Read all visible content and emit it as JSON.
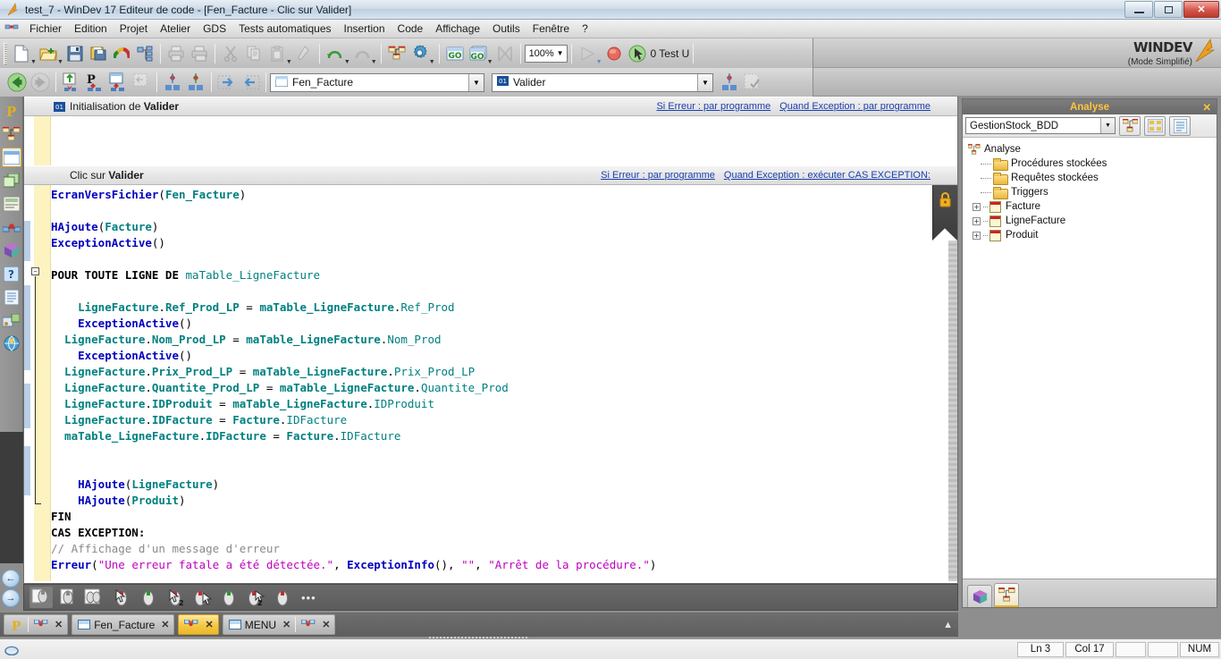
{
  "window": {
    "title": "test_7 - WinDev 17  Editeur de code - [Fen_Facture - Clic sur Valider]",
    "app_icon": "windev-flame-icon",
    "minimize": "–",
    "maximize": "❐",
    "close": "✕"
  },
  "menubar": {
    "logo_icon": "windev-small-icon",
    "items": [
      "Fichier",
      "Edition",
      "Projet",
      "Atelier",
      "GDS",
      "Tests automatiques",
      "Insertion",
      "Code",
      "Affichage",
      "Outils",
      "Fenêtre",
      "?"
    ]
  },
  "toolbar_main": {
    "zoom_value": "100%",
    "test_label": "0 Test U",
    "buttons": [
      {
        "name": "new-document-button",
        "icon": "page-icon",
        "dropdown": true
      },
      {
        "name": "open-project-button",
        "icon": "folder-open-icon",
        "dropdown": true
      },
      {
        "name": "save-button",
        "icon": "floppy-disk-icon",
        "dropdown": false
      },
      {
        "name": "save-all-button",
        "icon": "floppy-multi-icon",
        "dropdown": false
      },
      {
        "name": "dashboard-button",
        "icon": "gauge-icon",
        "dropdown": false
      },
      {
        "name": "project-structure-button",
        "icon": "tree-nodes-icon",
        "dropdown": false
      },
      {
        "name": "print-button",
        "icon": "printer-icon",
        "dropdown": false
      },
      {
        "name": "print-preview-button",
        "icon": "printer-preview-icon",
        "dropdown": false
      },
      {
        "name": "cut-button",
        "icon": "scissors-icon",
        "dropdown": false
      },
      {
        "name": "copy-button",
        "icon": "copy-icon",
        "dropdown": false
      },
      {
        "name": "paste-button",
        "icon": "clipboard-icon",
        "dropdown": true
      },
      {
        "name": "format-painter-button",
        "icon": "brush-icon",
        "dropdown": false
      },
      {
        "name": "undo-button",
        "icon": "undo-arrow-icon",
        "dropdown": true
      },
      {
        "name": "redo-button",
        "icon": "redo-arrow-icon",
        "dropdown": true
      },
      {
        "name": "analysis-button",
        "icon": "analysis-icon",
        "dropdown": false
      },
      {
        "name": "settings-button",
        "icon": "gear-icon",
        "dropdown": true
      },
      {
        "name": "go-button",
        "icon": "go-icon",
        "dropdown": false
      },
      {
        "name": "go-project-button",
        "icon": "go-project-icon",
        "dropdown": true
      },
      {
        "name": "stop-button",
        "icon": "hourglass-x-icon",
        "dropdown": false
      }
    ],
    "run_button_icon": "play-triangle-icon",
    "record_button_icon": "record-circle-icon",
    "testu_icon": "cursor-green-icon"
  },
  "toolbar_code": {
    "back_icon": "back-arrow-icon",
    "forward_icon": "forward-arrow-icon",
    "element_combo": {
      "icon": "window-icon",
      "value": "Fen_Facture"
    },
    "event_combo": {
      "icon": "code-event-icon",
      "value": "Valider"
    },
    "buttons": [
      {
        "name": "code-up-button",
        "icon": "code-up-icon"
      },
      {
        "name": "code-process-button",
        "icon": "code-process-icon"
      },
      {
        "name": "code-window-button",
        "icon": "code-window-icon"
      },
      {
        "name": "code-indent-button",
        "icon": "code-indent-icon"
      },
      {
        "name": "code-prev-button",
        "icon": "code-prev-icon"
      },
      {
        "name": "code-next-button",
        "icon": "code-next-icon"
      },
      {
        "name": "code-expand-button",
        "icon": "expand-right-icon"
      },
      {
        "name": "code-collapse-button",
        "icon": "collapse-left-icon"
      }
    ],
    "right_buttons": [
      {
        "name": "code-goto-button",
        "icon": "code-goto-icon"
      },
      {
        "name": "code-check-button",
        "icon": "code-check-icon"
      }
    ]
  },
  "brand": {
    "name": "WINDEV",
    "mode": "(Mode Simplifié)",
    "logo_icon": "windev-flame-icon",
    "colors_icon": "color-wheel-icon"
  },
  "leftbar": {
    "items": [
      {
        "name": "sidebar-item-project",
        "icon": "project-p-icon",
        "selected": false
      },
      {
        "name": "sidebar-item-analysis",
        "icon": "analysis-icon",
        "selected": false
      },
      {
        "name": "sidebar-item-window",
        "icon": "window-blue-icon",
        "selected": true
      },
      {
        "name": "sidebar-item-pages",
        "icon": "pages-green-icon",
        "selected": false
      },
      {
        "name": "sidebar-item-report",
        "icon": "report-icon",
        "selected": false
      },
      {
        "name": "sidebar-item-procedures",
        "icon": "procedures-icon",
        "selected": false
      },
      {
        "name": "sidebar-item-classes",
        "icon": "class-cube-icon",
        "selected": false
      },
      {
        "name": "sidebar-item-help",
        "icon": "question-help-icon",
        "selected": false
      },
      {
        "name": "sidebar-item-documents",
        "icon": "document-list-icon",
        "selected": false
      },
      {
        "name": "sidebar-item-components",
        "icon": "component-icon",
        "selected": false
      },
      {
        "name": "sidebar-item-web",
        "icon": "globe-icon",
        "selected": false
      }
    ]
  },
  "editor": {
    "events": [
      {
        "icon": "code-event-icon",
        "title_prefix": "Initialisation de ",
        "title_bold": "Valider",
        "link_error": "Si Erreur : par programme",
        "link_exception": "Quand Exception : par programme",
        "collapsed_empty": true
      },
      {
        "icon": "",
        "title_prefix": "Clic sur ",
        "title_bold": "Valider",
        "link_error": "Si Erreur : par programme",
        "link_exception": "Quand Exception : exécuter CAS EXCEPTION:",
        "collapsed_empty": false
      }
    ],
    "lock_icon": "padlock-icon",
    "code_lines": [
      [
        {
          "t": "EcranVersFichier",
          "c": "fn"
        },
        {
          "t": "(",
          "c": "plain"
        },
        {
          "t": "Fen_Facture",
          "c": "tealb"
        },
        {
          "t": ")",
          "c": "plain"
        }
      ],
      [],
      [
        {
          "t": "HAjoute",
          "c": "fn"
        },
        {
          "t": "(",
          "c": "plain"
        },
        {
          "t": "Facture",
          "c": "tealb"
        },
        {
          "t": ")",
          "c": "plain"
        }
      ],
      [
        {
          "t": "ExceptionActive",
          "c": "fn"
        },
        {
          "t": "()",
          "c": "plain"
        }
      ],
      [],
      [
        {
          "t": "POUR TOUTE LIGNE DE ",
          "c": "blk"
        },
        {
          "t": "maTable_LigneFacture",
          "c": "tealid"
        }
      ],
      [],
      [
        {
          "t": "    LigneFacture",
          "c": "tealb"
        },
        {
          "t": ".",
          "c": "plain"
        },
        {
          "t": "Ref_Prod_LP",
          "c": "tealb"
        },
        {
          "t": " = ",
          "c": "plain"
        },
        {
          "t": "maTable_LigneFacture",
          "c": "tealb"
        },
        {
          "t": ".",
          "c": "plain"
        },
        {
          "t": "Ref_Prod",
          "c": "tealid"
        }
      ],
      [
        {
          "t": "    ExceptionActive",
          "c": "fn"
        },
        {
          "t": "()",
          "c": "plain"
        }
      ],
      [
        {
          "t": "  LigneFacture",
          "c": "tealb"
        },
        {
          "t": ".",
          "c": "plain"
        },
        {
          "t": "Nom_Prod_LP",
          "c": "tealb"
        },
        {
          "t": " = ",
          "c": "plain"
        },
        {
          "t": "maTable_LigneFacture",
          "c": "tealb"
        },
        {
          "t": ".",
          "c": "plain"
        },
        {
          "t": "Nom_Prod",
          "c": "tealid"
        }
      ],
      [
        {
          "t": "    ExceptionActive",
          "c": "fn"
        },
        {
          "t": "()",
          "c": "plain"
        }
      ],
      [
        {
          "t": "  LigneFacture",
          "c": "tealb"
        },
        {
          "t": ".",
          "c": "plain"
        },
        {
          "t": "Prix_Prod_LP",
          "c": "tealb"
        },
        {
          "t": " = ",
          "c": "plain"
        },
        {
          "t": "maTable_LigneFacture",
          "c": "tealb"
        },
        {
          "t": ".",
          "c": "plain"
        },
        {
          "t": "Prix_Prod_LP",
          "c": "tealid"
        }
      ],
      [
        {
          "t": "  LigneFacture",
          "c": "tealb"
        },
        {
          "t": ".",
          "c": "plain"
        },
        {
          "t": "Quantite_Prod_LP",
          "c": "tealb"
        },
        {
          "t": " = ",
          "c": "plain"
        },
        {
          "t": "maTable_LigneFacture",
          "c": "tealb"
        },
        {
          "t": ".",
          "c": "plain"
        },
        {
          "t": "Quantite_Prod",
          "c": "tealid"
        }
      ],
      [
        {
          "t": "  LigneFacture",
          "c": "tealb"
        },
        {
          "t": ".",
          "c": "plain"
        },
        {
          "t": "IDProduit",
          "c": "tealb"
        },
        {
          "t": " = ",
          "c": "plain"
        },
        {
          "t": "maTable_LigneFacture",
          "c": "tealb"
        },
        {
          "t": ".",
          "c": "plain"
        },
        {
          "t": "IDProduit",
          "c": "tealid"
        }
      ],
      [
        {
          "t": "  LigneFacture",
          "c": "tealb"
        },
        {
          "t": ".",
          "c": "plain"
        },
        {
          "t": "IDFacture",
          "c": "tealb"
        },
        {
          "t": " = ",
          "c": "plain"
        },
        {
          "t": "Facture",
          "c": "tealb"
        },
        {
          "t": ".",
          "c": "plain"
        },
        {
          "t": "IDFacture",
          "c": "tealid"
        }
      ],
      [
        {
          "t": "  maTable_LigneFacture",
          "c": "tealb"
        },
        {
          "t": ".",
          "c": "plain"
        },
        {
          "t": "IDFacture",
          "c": "tealb"
        },
        {
          "t": " = ",
          "c": "plain"
        },
        {
          "t": "Facture",
          "c": "tealb"
        },
        {
          "t": ".",
          "c": "plain"
        },
        {
          "t": "IDFacture",
          "c": "tealid"
        }
      ],
      [],
      [],
      [
        {
          "t": "    HAjoute",
          "c": "fn"
        },
        {
          "t": "(",
          "c": "plain"
        },
        {
          "t": "LigneFacture",
          "c": "tealb"
        },
        {
          "t": ")",
          "c": "plain"
        }
      ],
      [
        {
          "t": "    HAjoute",
          "c": "fn"
        },
        {
          "t": "(",
          "c": "plain"
        },
        {
          "t": "Produit",
          "c": "tealb"
        },
        {
          "t": ")",
          "c": "plain"
        }
      ],
      [
        {
          "t": "FIN",
          "c": "blk"
        }
      ],
      [
        {
          "t": "CAS EXCEPTION:",
          "c": "blk"
        }
      ],
      [
        {
          "t": "// Affichage d'un message d'erreur",
          "c": "cmt"
        }
      ],
      [
        {
          "t": "Erreur",
          "c": "fn"
        },
        {
          "t": "(",
          "c": "plain"
        },
        {
          "t": "\"Une erreur fatale a été détectée.\"",
          "c": "str"
        },
        {
          "t": ", ",
          "c": "plain"
        },
        {
          "t": "ExceptionInfo",
          "c": "fn"
        },
        {
          "t": "(), ",
          "c": "plain"
        },
        {
          "t": "\"\"",
          "c": "str"
        },
        {
          "t": ", ",
          "c": "plain"
        },
        {
          "t": "\"Arrêt de la procédure.\"",
          "c": "str"
        },
        {
          "t": ")",
          "c": "plain"
        }
      ]
    ]
  },
  "editor_bottom_toolbar": {
    "tabs": [
      {
        "name": "code-tab-all",
        "icon": "mouse-all-icon"
      },
      {
        "name": "code-tab-declarations",
        "icon": "mouse-decl-icon"
      },
      {
        "name": "code-tab-group",
        "icon": "mouse-group-icon"
      },
      {
        "name": "code-tab-click",
        "icon": "mouse-cursor-icon"
      },
      {
        "name": "code-tab-init",
        "icon": "mouse-green-icon"
      },
      {
        "name": "code-tab-click2",
        "icon": "mouse-cursor2-icon"
      },
      {
        "name": "code-tab-hover",
        "icon": "mouse-cursor3-icon"
      },
      {
        "name": "code-tab-exit",
        "icon": "mouse-green2-icon"
      },
      {
        "name": "code-tab-modify",
        "icon": "mouse-cursor4-icon"
      },
      {
        "name": "code-tab-other",
        "icon": "mouse-red-icon"
      }
    ],
    "more": "•••"
  },
  "doctabs": {
    "groups": [
      {
        "name": "tab-group-project",
        "items": [
          {
            "name": "tab-project",
            "icon": "project-p-icon",
            "label": "",
            "close": "✕",
            "has_close": false
          },
          {
            "name": "tab-analysis",
            "icon": "analysis-icon",
            "label": "",
            "close": "✕",
            "has_close": true
          }
        ],
        "active": false
      },
      {
        "name": "tab-group-fen-facture",
        "items": [
          {
            "name": "tab-fen-facture",
            "icon": "window-icon",
            "label": "Fen_Facture",
            "close": "✕",
            "has_close": true
          }
        ],
        "active": false
      },
      {
        "name": "tab-group-fen-facture-code",
        "items": [
          {
            "name": "tab-fen-facture-code",
            "icon": "analysis-icon",
            "label": "",
            "close": "✕",
            "has_close": true
          }
        ],
        "active": true
      },
      {
        "name": "tab-group-menu",
        "items": [
          {
            "name": "tab-menu",
            "icon": "window-icon",
            "label": "MENU",
            "close": "✕",
            "has_close": true
          },
          {
            "name": "tab-menu-code",
            "icon": "analysis-icon",
            "label": "",
            "close": "✕",
            "has_close": true
          }
        ],
        "active": false
      }
    ],
    "collapse_icon": "chevron-up-icon"
  },
  "right_panel": {
    "title": "Analyse",
    "close": "✕",
    "combo_value": "GestionStock_BDD",
    "toolbar_buttons": [
      {
        "name": "analysis-structure-button",
        "icon": "analysis-icon"
      },
      {
        "name": "analysis-grid-button",
        "icon": "grid-icon"
      },
      {
        "name": "analysis-list-button",
        "icon": "list-icon"
      }
    ],
    "tree": [
      {
        "label": "Analyse",
        "type": "root",
        "icon": "analysis-icon",
        "indent": 0,
        "expander": "-"
      },
      {
        "label": "Procédures stockées",
        "type": "folder",
        "icon": "folder-icon",
        "indent": 1,
        "expander": ""
      },
      {
        "label": "Requêtes stockées",
        "type": "folder",
        "icon": "folder-icon",
        "indent": 1,
        "expander": ""
      },
      {
        "label": "Triggers",
        "type": "folder",
        "icon": "folder-icon",
        "indent": 1,
        "expander": ""
      },
      {
        "label": "Facture",
        "type": "file",
        "icon": "table-icon",
        "indent": 1,
        "expander": "+"
      },
      {
        "label": "LigneFacture",
        "type": "file",
        "icon": "table-icon",
        "indent": 1,
        "expander": "+"
      },
      {
        "label": "Produit",
        "type": "file",
        "icon": "table-icon",
        "indent": 1,
        "expander": "+"
      }
    ],
    "bottom_tabs": [
      {
        "name": "panel-tab-classes",
        "icon": "class-cube-icon",
        "selected": false
      },
      {
        "name": "panel-tab-analysis",
        "icon": "analysis-icon",
        "selected": true
      }
    ]
  },
  "statusbar": {
    "left_icon": "info-icon",
    "line": "Ln 3",
    "column": "Col 17",
    "blank1": "",
    "blank2": "",
    "num": "NUM"
  }
}
